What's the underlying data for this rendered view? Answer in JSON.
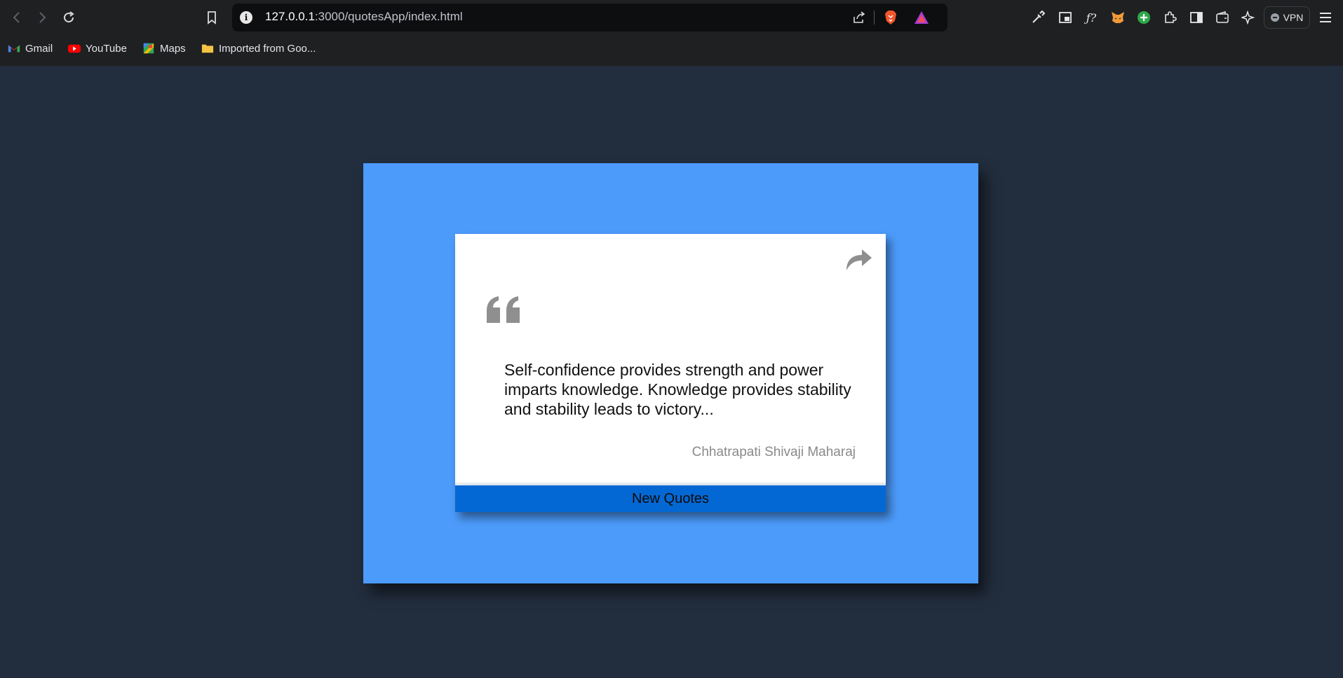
{
  "browser": {
    "url_host": "127.0.0.1",
    "url_path": ":3000/quotesApp/index.html",
    "vpn_label": "VPN",
    "bookmarks": [
      {
        "label": "Gmail",
        "icon": "gmail-icon"
      },
      {
        "label": "YouTube",
        "icon": "youtube-icon"
      },
      {
        "label": "Maps",
        "icon": "maps-icon"
      },
      {
        "label": "Imported from Goo...",
        "icon": "folder-icon"
      }
    ],
    "extensions": [
      "eyedropper-icon",
      "picture-in-picture-icon",
      "formula-icon",
      "metamask-icon",
      "add-icon",
      "extensions-puzzle-icon",
      "sidebar-icon",
      "wallet-icon",
      "leo-ai-icon"
    ]
  },
  "quote_card": {
    "text": "Self-confidence provides strength and power imparts knowledge. Knowledge provides stability and stability leads to victory...",
    "author": "Chhatrapati Shivaji Maharaj",
    "button_label": "New Quotes"
  },
  "colors": {
    "page_background": "#222d3d",
    "panel_background": "#4c9bfb",
    "button_background": "#0468d4",
    "card_background": "#ffffff",
    "icon_gray": "#8f8f8f"
  }
}
